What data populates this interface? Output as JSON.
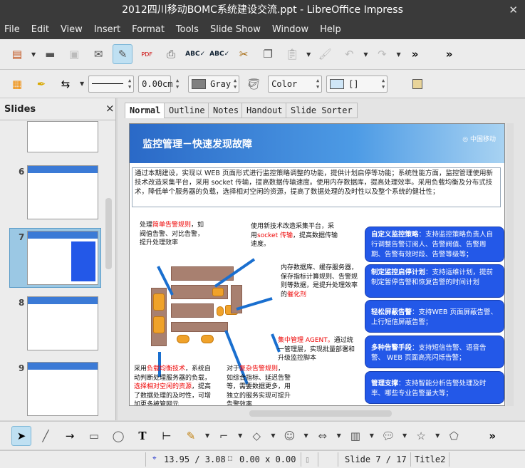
{
  "window": {
    "title": "2012四川移动BOMC系统建设交流.ppt - LibreOffice Impress",
    "close": "✕"
  },
  "menu": [
    "File",
    "Edit",
    "View",
    "Insert",
    "Format",
    "Tools",
    "Slide Show",
    "Window",
    "Help"
  ],
  "toolbar2": {
    "line_width": "0.00cm",
    "line_color": "Gray",
    "area_style": "Color",
    "area_fill": "[]"
  },
  "slides_panel": {
    "title": "Slides",
    "close": "×",
    "numbers": [
      "6",
      "7",
      "8",
      "9"
    ]
  },
  "tabs": [
    "Normal",
    "Outline",
    "Notes",
    "Handout",
    "Slide Sorter"
  ],
  "slide": {
    "title": "监控管理－快速发现故障",
    "intro": "通过本期建设，实现以 WEB 页面形式进行监控策略调整的功能，提供计划启停等功能；系统性能方面，监控管理使用新技术改造采集平台，采用 socket 传输，提高数据传输速度。使用内存数据库，提高处理效率。采用负载均衡及分布式技术，降低单个服务器的负载，选择相对空闲的资源，提高了数据处理的及时性以及整个系统的健壮性；",
    "notes": {
      "n1a": "处理",
      "n1r": "简单告警规则",
      "n1b": "，如阀值告警、对比告警，提升处理效率",
      "n2a": "使用新技术改造采集平台，采用",
      "n2r": "socket 传输",
      "n2b": "，提高数据传输速度。",
      "n3a": "内存数据库、缓存服务器，保存指标计算规则、告警规则等数据，是提升处理效率的",
      "n3r": "催化剂",
      "n4r": "集中管理 AGENT。",
      "n4b": "通过统一管理层，实现批量部署和升级监控脚本",
      "n5a": "采用",
      "n5r": "负载均衡技术",
      "n5b": "，系统自动判断处理服务器的负载，",
      "n5r2": "选择相对空闲的资源",
      "n5c": "，提高了数据处理的及时性，可增加更多被管网元",
      "n6a": "对于",
      "n6r": "复杂告警规则",
      "n6b": "，如综合指标、延迟告警等，需要数据更多，用独立的服务实现可提升告警效率"
    },
    "callouts": [
      {
        "head": "自定义监控策略",
        "body": "：支持监控策略负责人自行调整告警订阅人、告警阀值、告警周期、告警有效时段、告警等级等；"
      },
      {
        "head": "制定监控启停计划",
        "body": "：支持运维计划，提前制定暂停告警和恢复告警的时间计划"
      },
      {
        "head": "轻松屏蔽告警",
        "body": "：支持WEB 页面屏蔽告警、上行短信屏蔽告警；"
      },
      {
        "head": "多种告警手段",
        "body": "：支持短信告警、语音告警、 WEB 页面高亮闪烁告警；"
      },
      {
        "head": "管理支撑",
        "body": "：支持智能分析告警处理及时率、哪些专业告警量大等；"
      }
    ]
  },
  "status": {
    "position": "13.95 / 3.08",
    "size": "0.00 x 0.00",
    "slide": "Slide 7 / 17",
    "layout": "Title2"
  },
  "colors": {
    "callout": "#2358e8",
    "banner": "#2a69c7",
    "highlight": "#e00000"
  }
}
